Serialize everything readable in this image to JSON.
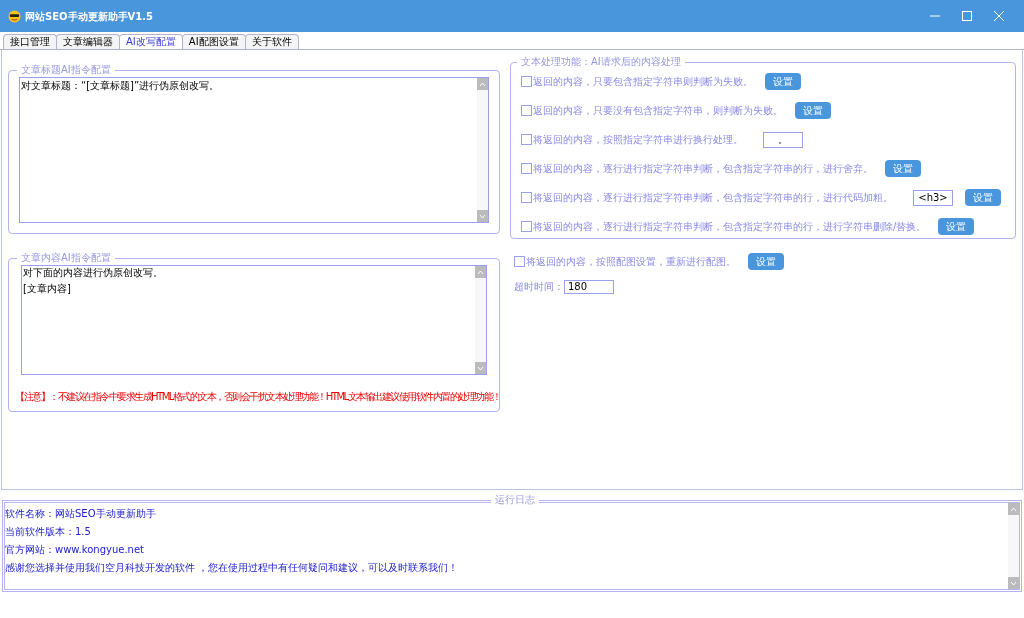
{
  "window": {
    "title": "网站SEO手动更新助手V1.5"
  },
  "tabs": [
    {
      "label": "接口管理",
      "selected": false
    },
    {
      "label": "文章编辑器",
      "selected": false
    },
    {
      "label": "AI改写配置",
      "selected": true
    },
    {
      "label": "AI配图设置",
      "selected": false
    },
    {
      "label": "关于软件",
      "selected": false
    }
  ],
  "title_prompt": {
    "legend": "文章标题AI指令配置",
    "lines": [
      "对文章标题：“[文章标题]”进行伪原创改写。"
    ]
  },
  "content_prompt": {
    "legend": "文章内容AI指令配置",
    "lines": [
      "对下面的内容进行伪原创改写。",
      "[文章内容]"
    ],
    "notice": "【注意】：不建议在指令中要求生成HTML格式的文本，否则会干扰文本处理功能！HTML文本输出建议使用软件内置的处理功能！"
  },
  "processing": {
    "legend": "文本处理功能：AI请求后的内容处理",
    "options": [
      {
        "label": "返回的内容，只要包含指定字符串则判断为失败。",
        "checked": false,
        "button": "设置"
      },
      {
        "label": "返回的内容，只要没有包含指定字符串，则判断为失败。",
        "checked": false,
        "button": "设置"
      },
      {
        "label": "将返回的内容，按照指定字符串进行换行处理。",
        "checked": false,
        "field": {
          "value": "。"
        }
      },
      {
        "label": "将返回的内容，逐行进行指定字符串判断，包含指定字符串的行，进行舍弃。",
        "checked": false,
        "button": "设置"
      },
      {
        "label": "将返回的内容，逐行进行指定字符串判断，包含指定字符串的行，进行代码加粗。",
        "checked": false,
        "field": {
          "value": "<h3>"
        },
        "button": "设置"
      },
      {
        "label": "将返回的内容，逐行进行指定字符串判断，包含指定字符串的行，进行字符串删除/替换。",
        "checked": false,
        "button": "设置"
      }
    ]
  },
  "reimage": {
    "label": "将返回的内容，按照配图设置，重新进行配图。",
    "checked": false,
    "button": "设置"
  },
  "timeout": {
    "label": "超时时间：",
    "value": "180"
  },
  "log": {
    "legend": "运行日志",
    "lines": [
      "软件名称：网站SEO手动更新助手",
      "当前软件版本：1.5",
      "官方网站：www.kongyue.net",
      "感谢您选择并使用我们空月科技开发的软件 ，您在使用过程中有任何疑问和建议，可以及时联系我们！"
    ]
  }
}
